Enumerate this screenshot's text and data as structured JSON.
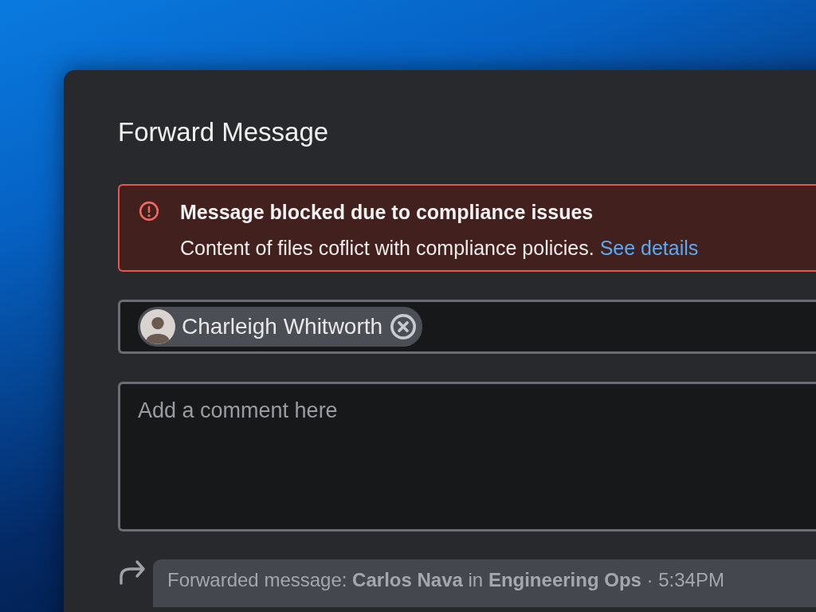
{
  "dialog": {
    "title": "Forward Message"
  },
  "alert": {
    "title": "Message blocked due to compliance issues",
    "message": "Content of files coflict with compliance policies.",
    "link": "See details"
  },
  "recipients": [
    {
      "name": "Charleigh Whitworth"
    }
  ],
  "comment": {
    "placeholder": "Add a comment here"
  },
  "forwarded": {
    "text": "Forwarded message: **Carlos Nava** in **Engineering Ops** · 5:34PM"
  }
}
